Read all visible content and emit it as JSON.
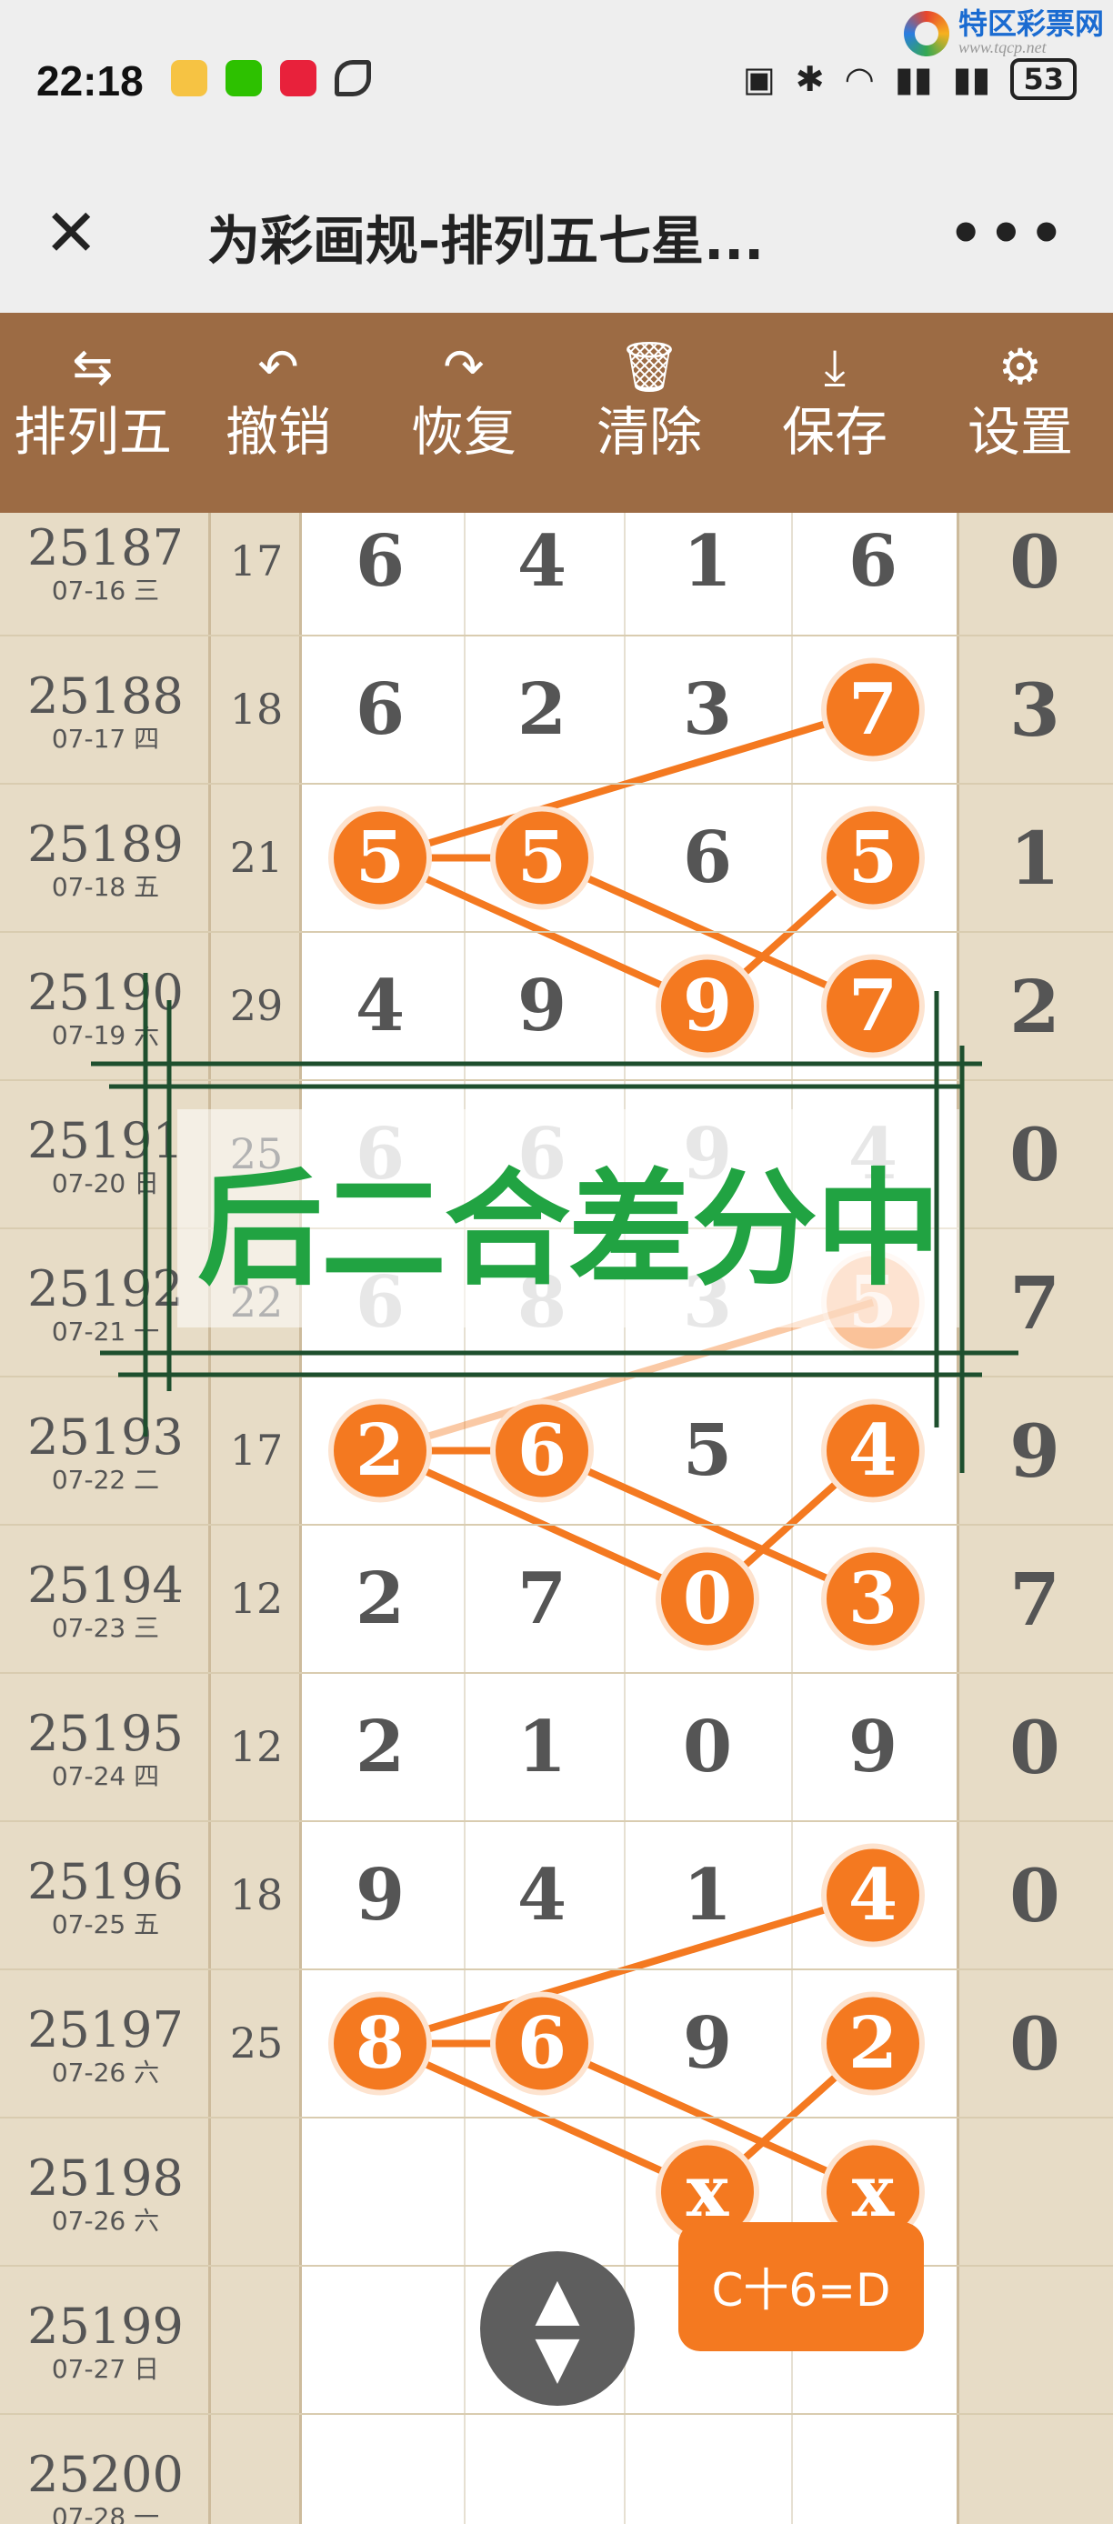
{
  "status_bar": {
    "time": "22:18",
    "battery": "53",
    "watermark_name": "特区彩票网",
    "watermark_url": "www.tqcp.net"
  },
  "title_bar": {
    "close_icon": "close-icon",
    "title": "为彩画规-排列五七星...",
    "more_icon": "more-icon"
  },
  "toolbar": [
    {
      "icon": "swap-icon",
      "label": "排列五"
    },
    {
      "icon": "undo-icon",
      "label": "撤销"
    },
    {
      "icon": "redo-icon",
      "label": "恢复"
    },
    {
      "icon": "trash-icon",
      "label": "清除"
    },
    {
      "icon": "download-icon",
      "label": "保存"
    },
    {
      "icon": "gear-icon",
      "label": "设置"
    }
  ],
  "rows": [
    {
      "issue": "25187",
      "date": "07-16 三",
      "sum": "17",
      "d": [
        "6",
        "4",
        "1",
        "6"
      ],
      "last": "0"
    },
    {
      "issue": "25188",
      "date": "07-17 四",
      "sum": "18",
      "d": [
        "6",
        "2",
        "3",
        "7"
      ],
      "last": "3"
    },
    {
      "issue": "25189",
      "date": "07-18 五",
      "sum": "21",
      "d": [
        "5",
        "5",
        "6",
        "5"
      ],
      "last": "1"
    },
    {
      "issue": "25190",
      "date": "07-19 六",
      "sum": "29",
      "d": [
        "4",
        "9",
        "9",
        "7"
      ],
      "last": "2"
    },
    {
      "issue": "25191",
      "date": "07-20 日",
      "sum": "25",
      "d": [
        "6",
        "6",
        "9",
        "4"
      ],
      "last": "0"
    },
    {
      "issue": "25192",
      "date": "07-21 一",
      "sum": "22",
      "d": [
        "6",
        "8",
        "3",
        "5"
      ],
      "last": "7"
    },
    {
      "issue": "25193",
      "date": "07-22 二",
      "sum": "17",
      "d": [
        "2",
        "6",
        "5",
        "4"
      ],
      "last": "9"
    },
    {
      "issue": "25194",
      "date": "07-23 三",
      "sum": "12",
      "d": [
        "2",
        "7",
        "0",
        "3"
      ],
      "last": "7"
    },
    {
      "issue": "25195",
      "date": "07-24 四",
      "sum": "12",
      "d": [
        "2",
        "1",
        "0",
        "9"
      ],
      "last": "0"
    },
    {
      "issue": "25196",
      "date": "07-25 五",
      "sum": "18",
      "d": [
        "9",
        "4",
        "1",
        "4"
      ],
      "last": "0"
    },
    {
      "issue": "25197",
      "date": "07-26 六",
      "sum": "25",
      "d": [
        "8",
        "6",
        "9",
        "2"
      ],
      "last": "0"
    },
    {
      "issue": "25198",
      "date": "07-26 六",
      "sum": "",
      "d": [
        "",
        "",
        "x",
        "x"
      ],
      "last": ""
    },
    {
      "issue": "25199",
      "date": "07-27 日",
      "sum": "",
      "d": [
        "",
        "",
        "",
        ""
      ],
      "last": ""
    },
    {
      "issue": "25200",
      "date": "07-28 一",
      "sum": "",
      "d": [
        "",
        "",
        "",
        ""
      ],
      "last": ""
    }
  ],
  "highlights": [
    [
      1,
      3
    ],
    [
      2,
      0
    ],
    [
      2,
      1
    ],
    [
      2,
      3
    ],
    [
      3,
      2
    ],
    [
      3,
      3
    ],
    [
      5,
      3
    ],
    [
      6,
      0
    ],
    [
      6,
      1
    ],
    [
      6,
      3
    ],
    [
      7,
      2
    ],
    [
      7,
      3
    ],
    [
      9,
      3
    ],
    [
      10,
      0
    ],
    [
      10,
      1
    ],
    [
      10,
      3
    ],
    [
      11,
      2
    ],
    [
      11,
      3
    ]
  ],
  "stamp": "后二合差分中",
  "formula_button": "C十6=D",
  "fab_icon": "up-down-icon",
  "colors": {
    "toolbar": "#9c6b44",
    "ball": "#f47920",
    "line": "#f47920",
    "stamp": "#21a342",
    "stamp_frame": "#1e4f2e"
  }
}
